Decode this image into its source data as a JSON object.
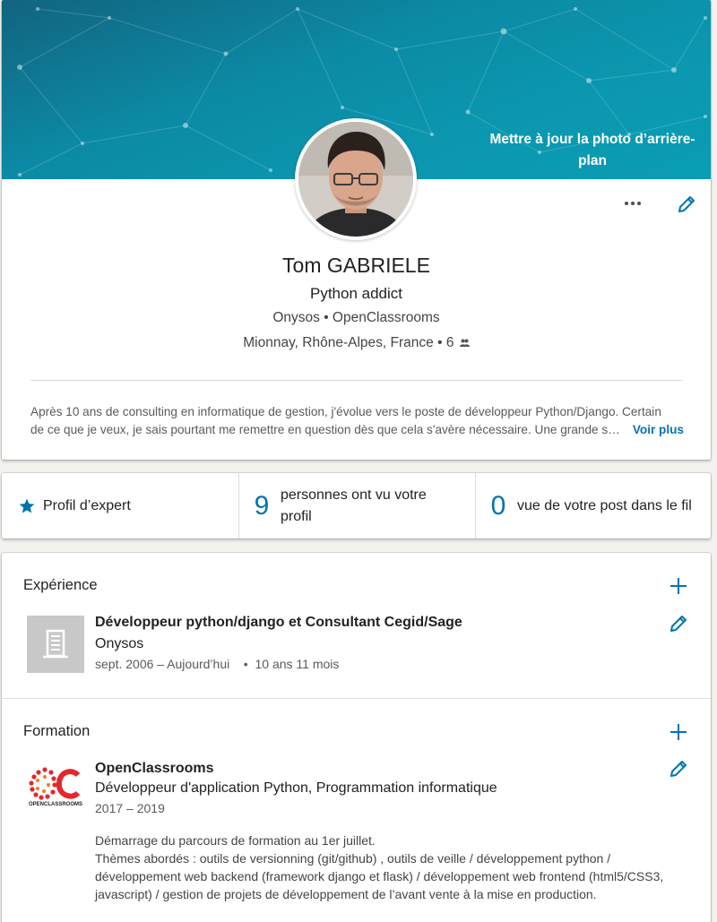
{
  "banner": {
    "update_photo_label": "Mettre à jour la photo d’arrière-plan"
  },
  "profile": {
    "name": "Tom GABRIELE",
    "headline": "Python addict",
    "current_company": "Onysos",
    "school": "OpenClassrooms",
    "location": "Mionnay, Rhône-Alpes, France",
    "connections": "6",
    "summary_line1": "Après 10 ans de consulting en informatique de gestion, j'évolue vers le poste de développeur Python/Django. Certain",
    "summary_line2": "de ce que je veux, je sais pourtant me remettre en question dès que cela s'avère nécessaire. Une grande s…",
    "see_more_label": "Voir plus"
  },
  "stats": {
    "expert_label": "Profil d’expert",
    "views_count": "9",
    "views_label_line1": "personnes ont vu votre",
    "views_label_line2": "profil",
    "post_views_count": "0",
    "post_views_label": "vue de votre post dans le fil"
  },
  "experience": {
    "title": "Expérience",
    "items": [
      {
        "role": "Développeur python/django et Consultant Cegid/Sage",
        "company": "Onysos",
        "dates": "sept. 2006 – Aujourd’hui",
        "duration": "10 ans 11 mois"
      }
    ]
  },
  "education": {
    "title": "Formation",
    "items": [
      {
        "school": "OpenClassrooms",
        "degree": "Développeur d'application Python, Programmation informatique",
        "dates": "2017 – 2019",
        "logo_text": "OPENCLASSROOMS",
        "description_line1": "Démarrage du parcours de formation au 1er juillet.",
        "description_line2": "Thèmes abordés  : outils de versionning (git/github) , outils de veille / développement python /",
        "description_line3": "développement web backend (framework django et flask) / développement web frontend (html5/CSS3,",
        "description_line4": "javascript) / gestion de projets de développement de l’avant vente à la mise en production."
      }
    ]
  },
  "colors": {
    "accent": "#0073b1",
    "banner": "#0b8aa6",
    "oc_logo": "#e2282c"
  }
}
